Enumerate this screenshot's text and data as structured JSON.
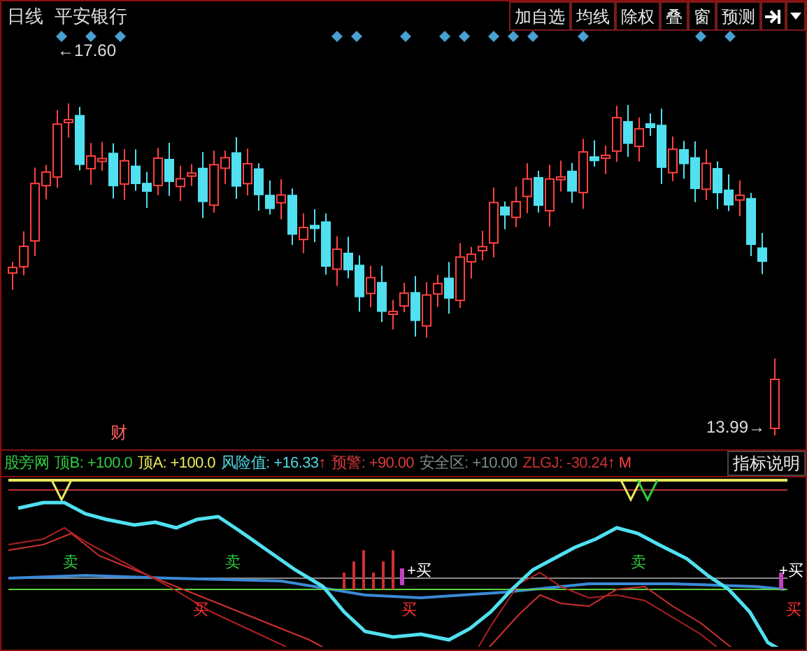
{
  "header": {
    "period": "日线",
    "stock": "平安银行"
  },
  "toolbar": [
    {
      "label": "加自选"
    },
    {
      "label": "均线"
    },
    {
      "label": "除权"
    },
    {
      "label": "叠"
    },
    {
      "label": "窗"
    },
    {
      "label": "预测"
    }
  ],
  "price_labels": {
    "high_arrow": "←",
    "high": "17.60",
    "low": "13.99",
    "low_arrow": "→"
  },
  "event_marker": "财",
  "legend": [
    {
      "label": "股旁网",
      "color": "#2ecc40"
    },
    {
      "label": "顶B:",
      "value": "+100.0",
      "color": "#2ecc40"
    },
    {
      "label": "顶A:",
      "value": "+100.0",
      "color": "#e8e85a"
    },
    {
      "label": "风险值:",
      "value": "+16.33",
      "suffix": "↑",
      "color": "#4fd8e0"
    },
    {
      "label": "预警:",
      "value": "+90.00",
      "color": "#d83a3a"
    },
    {
      "label": "安全区:",
      "value": "+10.00",
      "color": "#7a8a8a"
    },
    {
      "label": "ZLGJ:",
      "value": "-30.24",
      "suffix": "↑ M",
      "color": "#c83030"
    }
  ],
  "help_button": "指标说明",
  "signals": [
    {
      "kind": "sell",
      "text": "卖"
    },
    {
      "kind": "sell",
      "text": "卖"
    },
    {
      "kind": "cross",
      "text": "+买"
    },
    {
      "kind": "sell",
      "text": "卖"
    },
    {
      "kind": "cross",
      "text": "+买"
    },
    {
      "kind": "buy",
      "text": "买"
    },
    {
      "kind": "buy",
      "text": "买"
    },
    {
      "kind": "buy",
      "text": "买"
    }
  ]
}
